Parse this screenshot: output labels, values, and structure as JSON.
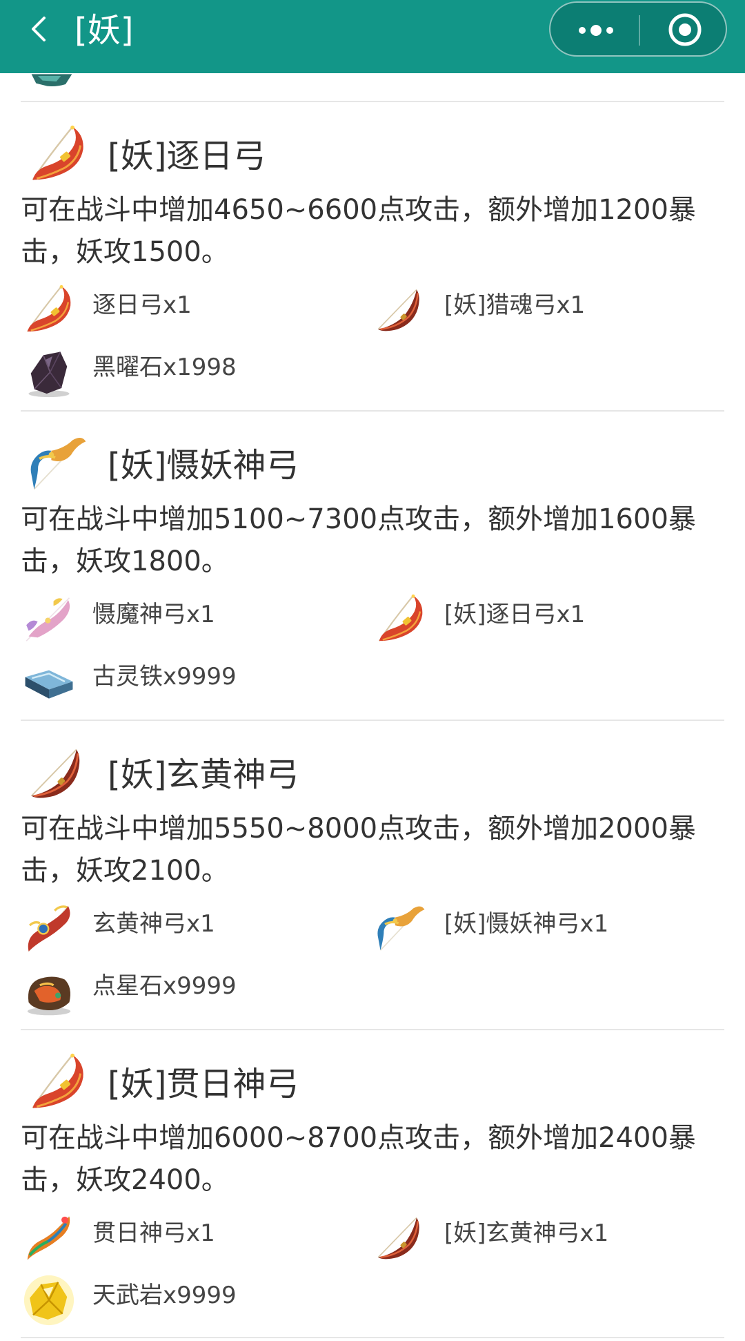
{
  "header": {
    "title": "[妖]",
    "back_icon": "chevron-left-icon",
    "more_icon": "more-dots-icon",
    "close_icon": "record-circle-icon",
    "background": "#129688"
  },
  "items": [
    {
      "name": "[妖]逐日弓",
      "icon": "red-bow-icon",
      "desc": "可在战斗中增加4650~6600点攻击，额外增加1200暴击，妖攻1500。",
      "materials": [
        {
          "label": "逐日弓x1",
          "icon": "red-bow-icon"
        },
        {
          "label": "[妖]猎魂弓x1",
          "icon": "crescent-bow-icon"
        },
        {
          "label": "黑曜石x1998",
          "icon": "obsidian-stone-icon"
        }
      ]
    },
    {
      "name": "[妖]慑妖神弓",
      "icon": "blue-gold-bow-icon",
      "desc": "可在战斗中增加5100~7300点攻击，额外增加1600暴击，妖攻1800。",
      "materials": [
        {
          "label": "慑魔神弓x1",
          "icon": "pink-bow-icon"
        },
        {
          "label": "[妖]逐日弓x1",
          "icon": "red-bow-icon"
        },
        {
          "label": "古灵铁x9999",
          "icon": "iron-ingot-icon"
        }
      ]
    },
    {
      "name": "[妖]玄黄神弓",
      "icon": "crescent-bow-icon",
      "desc": "可在战斗中增加5550~8000点攻击，额外增加2000暴击，妖攻2100。",
      "materials": [
        {
          "label": "玄黄神弓x1",
          "icon": "ornate-bow-icon"
        },
        {
          "label": "[妖]慑妖神弓x1",
          "icon": "blue-gold-bow-icon"
        },
        {
          "label": "点星石x9999",
          "icon": "star-stone-icon"
        }
      ]
    },
    {
      "name": "[妖]贯日神弓",
      "icon": "red-bow-icon",
      "desc": "可在战斗中增加6000~8700点攻击，额外增加2400暴击，妖攻2400。",
      "materials": [
        {
          "label": "贯日神弓x1",
          "icon": "rainbow-bow-icon"
        },
        {
          "label": "[妖]玄黄神弓x1",
          "icon": "crescent-bow-icon"
        },
        {
          "label": "天武岩x9999",
          "icon": "gold-ore-icon"
        }
      ]
    }
  ]
}
